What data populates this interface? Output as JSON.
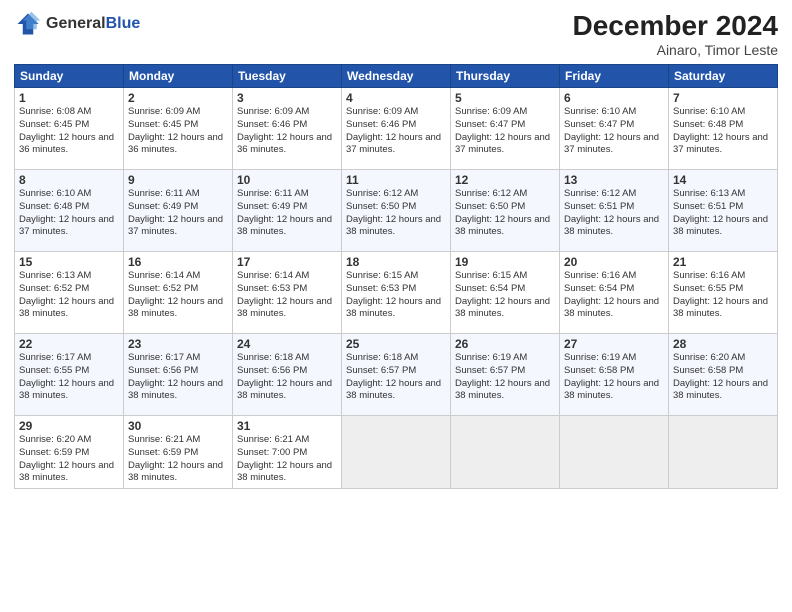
{
  "header": {
    "logo_general": "General",
    "logo_blue": "Blue",
    "month": "December 2024",
    "location": "Ainaro, Timor Leste"
  },
  "weekdays": [
    "Sunday",
    "Monday",
    "Tuesday",
    "Wednesday",
    "Thursday",
    "Friday",
    "Saturday"
  ],
  "weeks": [
    [
      {
        "day": "1",
        "sunrise": "6:08 AM",
        "sunset": "6:45 PM",
        "daylight": "12 hours and 36 minutes."
      },
      {
        "day": "2",
        "sunrise": "6:09 AM",
        "sunset": "6:45 PM",
        "daylight": "12 hours and 36 minutes."
      },
      {
        "day": "3",
        "sunrise": "6:09 AM",
        "sunset": "6:46 PM",
        "daylight": "12 hours and 36 minutes."
      },
      {
        "day": "4",
        "sunrise": "6:09 AM",
        "sunset": "6:46 PM",
        "daylight": "12 hours and 37 minutes."
      },
      {
        "day": "5",
        "sunrise": "6:09 AM",
        "sunset": "6:47 PM",
        "daylight": "12 hours and 37 minutes."
      },
      {
        "day": "6",
        "sunrise": "6:10 AM",
        "sunset": "6:47 PM",
        "daylight": "12 hours and 37 minutes."
      },
      {
        "day": "7",
        "sunrise": "6:10 AM",
        "sunset": "6:48 PM",
        "daylight": "12 hours and 37 minutes."
      }
    ],
    [
      {
        "day": "8",
        "sunrise": "6:10 AM",
        "sunset": "6:48 PM",
        "daylight": "12 hours and 37 minutes."
      },
      {
        "day": "9",
        "sunrise": "6:11 AM",
        "sunset": "6:49 PM",
        "daylight": "12 hours and 37 minutes."
      },
      {
        "day": "10",
        "sunrise": "6:11 AM",
        "sunset": "6:49 PM",
        "daylight": "12 hours and 38 minutes."
      },
      {
        "day": "11",
        "sunrise": "6:12 AM",
        "sunset": "6:50 PM",
        "daylight": "12 hours and 38 minutes."
      },
      {
        "day": "12",
        "sunrise": "6:12 AM",
        "sunset": "6:50 PM",
        "daylight": "12 hours and 38 minutes."
      },
      {
        "day": "13",
        "sunrise": "6:12 AM",
        "sunset": "6:51 PM",
        "daylight": "12 hours and 38 minutes."
      },
      {
        "day": "14",
        "sunrise": "6:13 AM",
        "sunset": "6:51 PM",
        "daylight": "12 hours and 38 minutes."
      }
    ],
    [
      {
        "day": "15",
        "sunrise": "6:13 AM",
        "sunset": "6:52 PM",
        "daylight": "12 hours and 38 minutes."
      },
      {
        "day": "16",
        "sunrise": "6:14 AM",
        "sunset": "6:52 PM",
        "daylight": "12 hours and 38 minutes."
      },
      {
        "day": "17",
        "sunrise": "6:14 AM",
        "sunset": "6:53 PM",
        "daylight": "12 hours and 38 minutes."
      },
      {
        "day": "18",
        "sunrise": "6:15 AM",
        "sunset": "6:53 PM",
        "daylight": "12 hours and 38 minutes."
      },
      {
        "day": "19",
        "sunrise": "6:15 AM",
        "sunset": "6:54 PM",
        "daylight": "12 hours and 38 minutes."
      },
      {
        "day": "20",
        "sunrise": "6:16 AM",
        "sunset": "6:54 PM",
        "daylight": "12 hours and 38 minutes."
      },
      {
        "day": "21",
        "sunrise": "6:16 AM",
        "sunset": "6:55 PM",
        "daylight": "12 hours and 38 minutes."
      }
    ],
    [
      {
        "day": "22",
        "sunrise": "6:17 AM",
        "sunset": "6:55 PM",
        "daylight": "12 hours and 38 minutes."
      },
      {
        "day": "23",
        "sunrise": "6:17 AM",
        "sunset": "6:56 PM",
        "daylight": "12 hours and 38 minutes."
      },
      {
        "day": "24",
        "sunrise": "6:18 AM",
        "sunset": "6:56 PM",
        "daylight": "12 hours and 38 minutes."
      },
      {
        "day": "25",
        "sunrise": "6:18 AM",
        "sunset": "6:57 PM",
        "daylight": "12 hours and 38 minutes."
      },
      {
        "day": "26",
        "sunrise": "6:19 AM",
        "sunset": "6:57 PM",
        "daylight": "12 hours and 38 minutes."
      },
      {
        "day": "27",
        "sunrise": "6:19 AM",
        "sunset": "6:58 PM",
        "daylight": "12 hours and 38 minutes."
      },
      {
        "day": "28",
        "sunrise": "6:20 AM",
        "sunset": "6:58 PM",
        "daylight": "12 hours and 38 minutes."
      }
    ],
    [
      {
        "day": "29",
        "sunrise": "6:20 AM",
        "sunset": "6:59 PM",
        "daylight": "12 hours and 38 minutes."
      },
      {
        "day": "30",
        "sunrise": "6:21 AM",
        "sunset": "6:59 PM",
        "daylight": "12 hours and 38 minutes."
      },
      {
        "day": "31",
        "sunrise": "6:21 AM",
        "sunset": "7:00 PM",
        "daylight": "12 hours and 38 minutes."
      },
      null,
      null,
      null,
      null
    ]
  ]
}
